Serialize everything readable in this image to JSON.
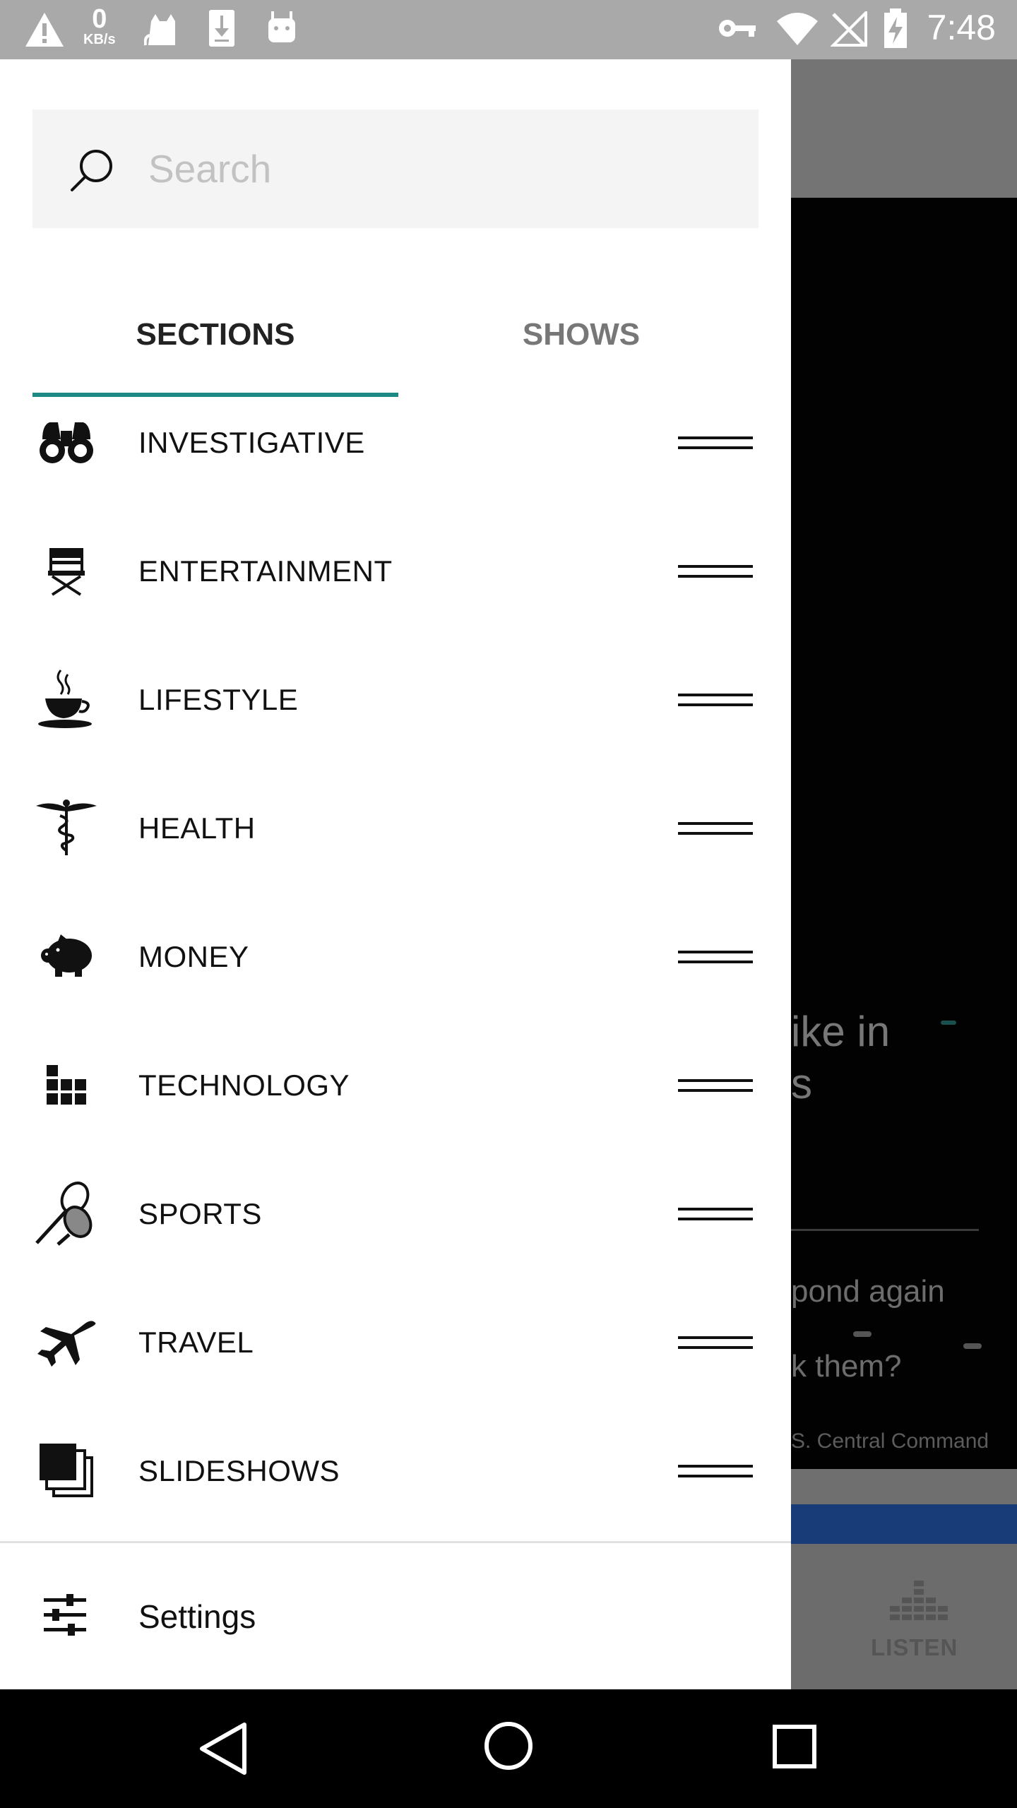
{
  "status_bar": {
    "time": "7:48",
    "net_speed_value": "0",
    "net_speed_unit": "KB/s",
    "icons": [
      "warning-icon",
      "cat-icon",
      "download-icon",
      "android-icon",
      "vpn-key-icon",
      "wifi-icon",
      "no-signal-icon",
      "battery-charging-icon"
    ]
  },
  "search": {
    "placeholder": "Search",
    "value": ""
  },
  "tabs": [
    {
      "label": "SECTIONS",
      "selected": true
    },
    {
      "label": "SHOWS",
      "selected": false
    }
  ],
  "sections": [
    {
      "label": "INVESTIGATIVE",
      "icon": "binoculars-icon"
    },
    {
      "label": "ENTERTAINMENT",
      "icon": "directors-chair-icon"
    },
    {
      "label": "LIFESTYLE",
      "icon": "coffee-cup-icon"
    },
    {
      "label": "HEALTH",
      "icon": "caduceus-icon"
    },
    {
      "label": "MONEY",
      "icon": "piggy-bank-icon"
    },
    {
      "label": "TECHNOLOGY",
      "icon": "grid-blocks-icon"
    },
    {
      "label": "SPORTS",
      "icon": "tennis-rackets-icon"
    },
    {
      "label": "TRAVEL",
      "icon": "airplane-icon"
    },
    {
      "label": "SLIDESHOWS",
      "icon": "stacked-slides-icon"
    }
  ],
  "settings": {
    "label": "Settings",
    "icon": "sliders-icon"
  },
  "background": {
    "headline": "ike in\ns",
    "line1": "pond again",
    "line2": "k them?",
    "caption": "S. Central Command",
    "listen_label": "LISTEN"
  },
  "colors": {
    "tab_indicator": "#1c8a82",
    "status_bar": "#a9a9a9",
    "drawer_bg": "#ffffff",
    "search_bg": "#f4f4f4",
    "bg_blue_strip": "#183c78"
  }
}
